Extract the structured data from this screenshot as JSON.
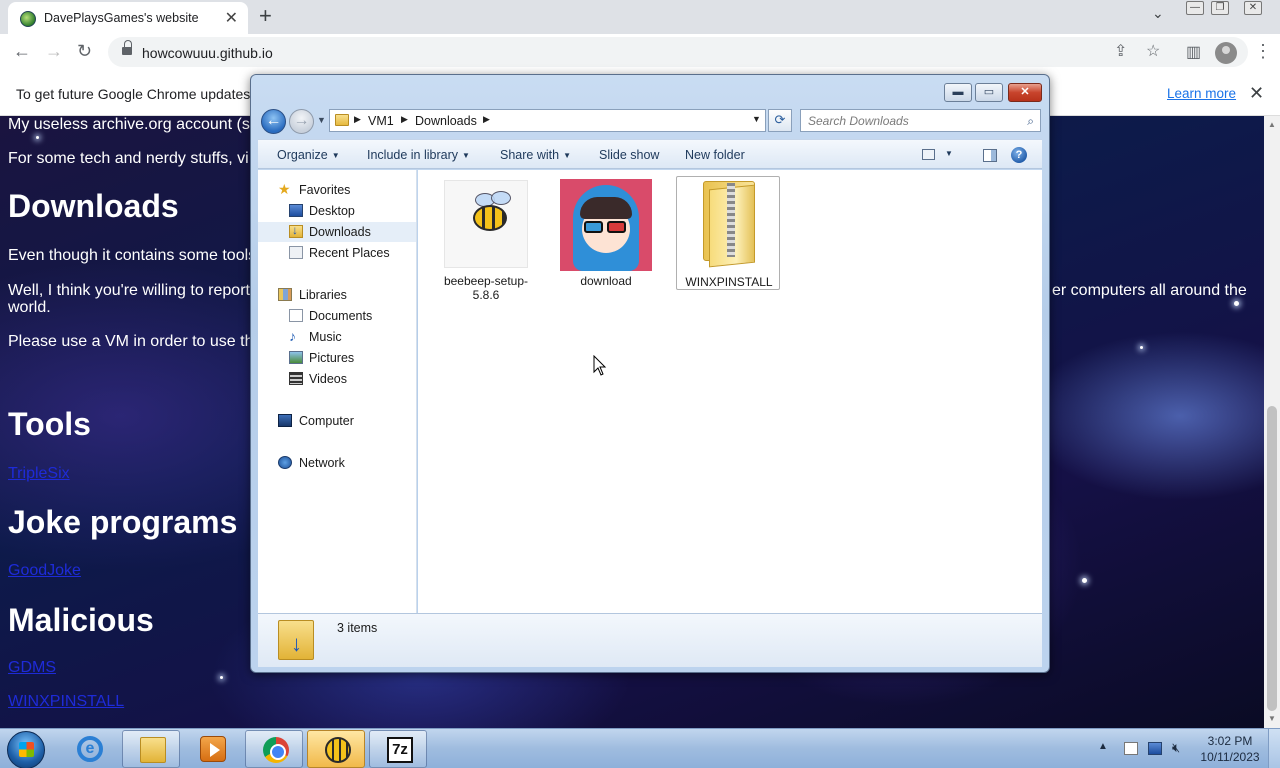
{
  "browser": {
    "tab_title": "DavePlaysGames's website",
    "url": "howcowuuu.github.io",
    "infobar_message": "To get future Google Chrome updates, yo",
    "infobar_link": "Learn more"
  },
  "page": {
    "line1": "My useless archive.org account (s",
    "line2": "For some tech and nerdy stuffs, vi",
    "heading_downloads": "Downloads",
    "line3": "Even though it contains some tools",
    "line4a": "Well, I think you're willing to report",
    "line4b": "er computers all around the",
    "line4c": "world.",
    "line5": "Please use a VM in order to use th",
    "heading_tools": "Tools",
    "link_tools": "TripleSix",
    "heading_joke": "Joke programs",
    "link_joke": "GoodJoke",
    "heading_malicious": "Malicious",
    "link_mal1": "GDMS",
    "link_mal2": "WINXPINSTALL"
  },
  "explorer": {
    "breadcrumb": [
      "VM1",
      "Downloads"
    ],
    "search_placeholder": "Search Downloads",
    "commands": {
      "organize": "Organize",
      "include": "Include in library",
      "share": "Share with",
      "slideshow": "Slide show",
      "newfolder": "New folder"
    },
    "nav": {
      "favorites": "Favorites",
      "desktop": "Desktop",
      "downloads": "Downloads",
      "recent": "Recent Places",
      "libraries": "Libraries",
      "documents": "Documents",
      "music": "Music",
      "pictures": "Pictures",
      "videos": "Videos",
      "computer": "Computer",
      "network": "Network"
    },
    "files": [
      {
        "name": "beebeep-setup-5.8.6"
      },
      {
        "name": "download"
      },
      {
        "name": "WINXPINSTALL"
      }
    ],
    "item_count": "3 items"
  },
  "taskbar": {
    "time": "3:02 PM",
    "date": "10/11/2023"
  },
  "colors": {
    "link": "#1e2bd8",
    "chrome_link": "#1a73e8",
    "selected_nav": "#e5eef8"
  }
}
